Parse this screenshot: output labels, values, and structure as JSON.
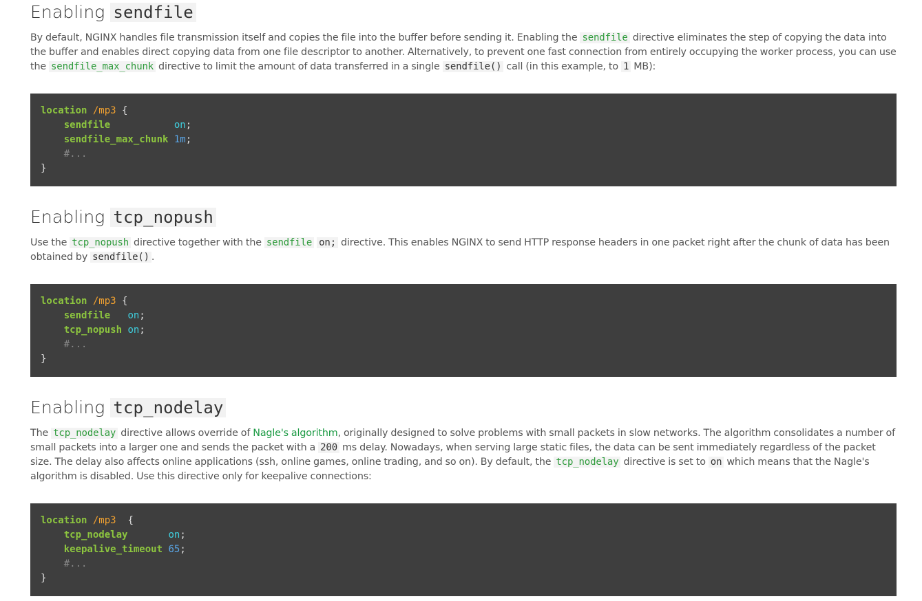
{
  "sec1": {
    "h_prefix": "Enabling ",
    "h_code": "sendfile",
    "p": [
      "By default, NGINX handles file transmission itself and copies the file into the buffer before sending it. Enabling the ",
      "sendfile",
      " directive eliminates the step of copying the data into the buffer and enables direct copying data from one file descriptor to another. Alternatively, to prevent one fast connection from entirely occupying the worker process, you can use the ",
      "sendfile_max_chunk",
      " directive to limit the amount of data transferred in a single ",
      "sendfile()",
      " call (in this example, to ",
      "1",
      " MB):"
    ],
    "code": {
      "l1_kw": "location",
      "l1_path": "/mp3",
      "l1_brace": " {",
      "l2_dir": "sendfile",
      "l2_val": "on",
      "l2_semi": ";",
      "l3_dir": "sendfile_max_chunk",
      "l3_val": "1m",
      "l3_semi": ";",
      "l4_cmt": "#...",
      "l5": "}"
    }
  },
  "sec2": {
    "h_prefix": "Enabling ",
    "h_code": "tcp_nopush",
    "p": [
      "Use the ",
      "tcp_nopush",
      " directive together with the ",
      "sendfile",
      " ",
      "on;",
      " directive. This enables NGINX to send HTTP response headers in one packet right after the chunk of data has been obtained by ",
      "sendfile()",
      "."
    ],
    "code": {
      "l1_kw": "location",
      "l1_path": "/mp3",
      "l1_brace": " {",
      "l2_dir": "sendfile",
      "l2_val": "on",
      "l2_semi": ";",
      "l3_dir": "tcp_nopush",
      "l3_val": "on",
      "l3_semi": ";",
      "l4_cmt": "#...",
      "l5": "}"
    }
  },
  "sec3": {
    "h_prefix": "Enabling ",
    "h_code": "tcp_nodelay",
    "p": [
      "The ",
      "tcp_nodelay",
      " directive allows override of ",
      "Nagle's algorithm",
      ", originally designed to solve problems with small packets in slow networks. The algorithm consolidates a number of small packets into a larger one and sends the packet with a ",
      "200",
      " ms delay. Nowadays, when serving large static files, the data can be sent immediately regardless of the packet size. The delay also affects online applications (ssh, online games, online trading, and so on). By default, the ",
      "tcp_nodelay",
      " directive is set to ",
      "on",
      " which means that the Nagle's algorithm is disabled. Use this directive only for keepalive connections:"
    ],
    "code": {
      "l1_kw": "location",
      "l1_path": "/mp3",
      "l1_brace": "  {",
      "l2_dir": "tcp_nodelay",
      "l2_val": "on",
      "l2_semi": ";",
      "l3_dir": "keepalive_timeout",
      "l3_val": "65",
      "l3_semi": ";",
      "l4_cmt": "#...",
      "l5": "}"
    }
  }
}
